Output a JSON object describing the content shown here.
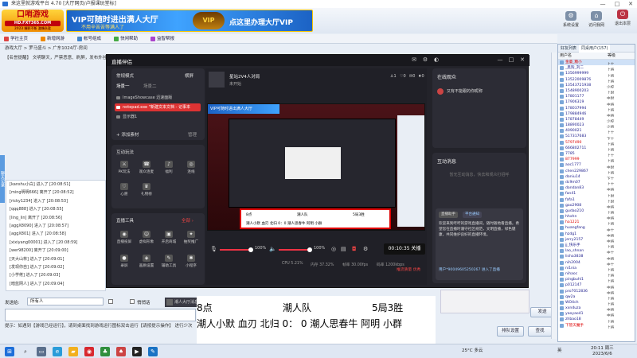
{
  "lobby": {
    "title": "来这里就游戏平台 4.70 [大厅网页/卢报课玩堂标]",
    "logo": {
      "line1": "口哨游戏",
      "line2": "HD.FXT365.COM",
      "line3": "2023 精彩不断 激情永驻"
    },
    "ad": {
      "main": "VIP可随时进出满人大厅",
      "sub": "不用辛苦苦等满人了",
      "badge": "VIP",
      "right": "点这里办理大厅VIP"
    },
    "tools": [
      {
        "label": "系统设置",
        "icon": "⚙"
      },
      {
        "label": "访问我网",
        "icon": "⌂"
      },
      {
        "label": "",
        "icon": "☺"
      },
      {
        "label": "退出本层",
        "icon": "⏻"
      }
    ],
    "window_controls": [
      "—",
      "□",
      "✕"
    ],
    "menu": [
      "学社主页",
      "新增网游",
      "帐号组成",
      "快闲帮助",
      "益智帮报"
    ],
    "breadcrumb": "游戏大厅 > 罗马盛斗 > 广东1024厅-房间",
    "room_tip": "【名誉提醒】 文明聊天，严禁恶意、刷屏，发布外挂",
    "sidebar_tab": "聊天记录",
    "chat_log": [
      "[kanshu小白] 进入了 [20:08:51]",
      "[ming明明666] 离开了 [20:08:52]",
      "[ricky1234] 进入了 [20:08:53]",
      "[qqq888] 进入了 [20:08:55]",
      "[ling_lin] 离开了 [20:08:56]",
      "[aggX8090] 进入了 [20:08:57]",
      "[aggX801] 进入了 [20:08:58]",
      "[xixiyang00001] 进入了 [20:08:59]",
      "[wer98200] 离开了 [20:09:00]",
      "[天大山林] 进入了 [20:09:01]",
      "[发现你自] 进入了 [20:09:02]",
      "[小学佬] 进入了 [20:09:03]",
      "[暗蓝网人] 进入了 [20:09:04]"
    ],
    "chat_target_label": "发送给:",
    "chat_target": "所有人",
    "chat_option": "悄悄话",
    "tip_bar": "提示：如遇到【游戏已经运行】，请到桌面找到游戏运行图标双击运行【请按提示操作】 进行少次",
    "buttons": {
      "send": "发送",
      "queue": "排队设置",
      "search": "查找"
    },
    "user_tabs": [
      "好友列表",
      "同桌用户(157)"
    ],
    "user_header": [
      "用户名",
      "等级"
    ],
    "users": [
      {
        "name": "金童_糖小",
        "rank": "上士",
        "red": true
      },
      {
        "name": "_黑狗_刘二",
        "rank": "上将",
        "red": false
      },
      {
        "name": "1356999999",
        "rank": "上将",
        "red": false
      },
      {
        "name": "13522009876",
        "rank": "上将",
        "red": false
      },
      {
        "name": "13543721938",
        "rank": "少校",
        "red": false
      },
      {
        "name": "1548900203",
        "rank": "上尉",
        "red": false
      },
      {
        "name": "17801177",
        "rank": "中尉",
        "red": false
      },
      {
        "name": "17906319",
        "rank": "中将",
        "red": false
      },
      {
        "name": "178037994",
        "rank": "上将",
        "red": false
      },
      {
        "name": "179884946",
        "rank": "中将",
        "red": false
      },
      {
        "name": "17878449",
        "rank": "少校",
        "red": false
      },
      {
        "name": "18890023",
        "rank": "少将",
        "red": false
      },
      {
        "name": "4090021",
        "rank": "上士",
        "red": false
      },
      {
        "name": "517317683",
        "rank": "下士",
        "red": false
      },
      {
        "name": "5797490",
        "rank": "上将",
        "red": true
      },
      {
        "name": "666802711",
        "rank": "上将",
        "red": false
      },
      {
        "name": "7785",
        "rank": "上士",
        "red": false
      },
      {
        "name": "877999",
        "rank": "上将",
        "red": true
      },
      {
        "name": "aoc1777",
        "rank": "中尉",
        "red": false
      },
      {
        "name": "chen229867",
        "rank": "上将",
        "red": false
      },
      {
        "name": "daniu14",
        "rank": "下士",
        "red": false
      },
      {
        "name": "dc9m07",
        "rank": "上士",
        "red": false
      },
      {
        "name": "dandan83",
        "rank": "中将",
        "red": false
      },
      {
        "name": "fan41",
        "rank": "上尉",
        "red": false
      },
      {
        "name": "fafa1",
        "rank": "上尉",
        "red": false
      },
      {
        "name": "gao2908",
        "rank": "中将",
        "red": false
      },
      {
        "name": "gudao210",
        "rank": "上将",
        "red": false
      },
      {
        "name": "hhxhn",
        "rank": "中将",
        "red": false
      },
      {
        "name": "ha1221",
        "rank": "上将",
        "red": true
      },
      {
        "name": "huangfang",
        "rank": "中士",
        "red": false
      },
      {
        "name": "hzdg1",
        "rank": "中将",
        "red": false
      },
      {
        "name": "jerry2157",
        "rank": "中将",
        "red": false
      },
      {
        "name": "jj_快乐手",
        "rank": "上将",
        "red": false
      },
      {
        "name": "lao_shnan",
        "rank": "中士",
        "red": false
      },
      {
        "name": "lisha3838",
        "rank": "中将",
        "red": false
      },
      {
        "name": "nih2004",
        "rank": "中士",
        "red": false
      },
      {
        "name": "ni1nia",
        "rank": "上将",
        "red": false
      },
      {
        "name": "nihaoc",
        "rank": "上将",
        "red": false
      },
      {
        "name": "pingbuhl1",
        "rank": "上将",
        "red": false
      },
      {
        "name": "p012147",
        "rank": "中将",
        "red": false
      },
      {
        "name": "pro7012836",
        "rank": "中将",
        "red": false
      },
      {
        "name": "qw2a",
        "rank": "上将",
        "red": false
      },
      {
        "name": "WO4ch",
        "rank": "上将",
        "red": false
      },
      {
        "name": "xxnduza",
        "rank": "中将",
        "red": false
      },
      {
        "name": "yaoyao41",
        "rank": "中将",
        "red": false
      },
      {
        "name": "zhbao18",
        "rank": "上将",
        "red": false
      },
      {
        "name": "下管天魔手",
        "rank": "上将",
        "red": true
      }
    ]
  },
  "stream": {
    "title": "直播伴侣",
    "scene_mode": "常规模式",
    "landscape": "横屏",
    "scene_tab1": "场景一",
    "scene_tab2": "场景二",
    "sources": [
      "ImageShowcase 迅速面版",
      "notepad.exe \"新建文本文档 - 记事本",
      "显示器1"
    ],
    "add_source": "添加素材",
    "manage": "管理",
    "interact_title": "互动玩法",
    "interact_items": [
      "PK玩法",
      "观众连麦",
      "福利",
      "连线",
      "心愿",
      "礼物榜"
    ],
    "tools_title": "直播工具",
    "tools_all": "全部 ›",
    "tools_items": [
      "直播投屏",
      "虚拟形象",
      "开启商城",
      "抽奖推广",
      "录屏",
      "画质设置",
      "辅助工具",
      "小程序"
    ],
    "stream_name": "星站2V4人对局",
    "stream_sub": "未开始",
    "stats_items": [
      "1",
      "0",
      "0",
      "0"
    ],
    "score_preview": {
      "row1": [
        "8点",
        "潮人队",
        "5局3胜"
      ],
      "row2": "潮人小默 血刃 北归 0：0 潮人思春牛 阿明 小群"
    },
    "mic_pct": "100%",
    "speaker_pct": "100%",
    "timer": "00:10:35 关播",
    "stats_bar": [
      "CPU 5.21%",
      "内存 37.32%",
      "帧率 30.00fps",
      "码率 1200kbps"
    ],
    "stream_quality": "推流质量 优秀",
    "online_title": "在线观众",
    "viewer": "又有不能跟的你昵称",
    "msg_title": "互动消息",
    "msg_empty": "暂无互动消息，快去和观众打招呼",
    "sys_tag": "直播助手",
    "sys_tag2": "平台通知",
    "sys_body": "欢迎来到哔哔的游戏直播间，随时随地看直播。希望您在直播时遵守社区规范，文明直播，绿色健康，共同维护良好的直播环境。",
    "sys_user": "用户*90049605250267 进入了直播",
    "toast": "潮人大厅消息"
  },
  "overlay": {
    "time": "8点",
    "team": "潮人队",
    "format": "5局3胜",
    "players": "潮人小默  血刃  北归 0： 0 潮人思春牛 阿明  小群"
  },
  "taskbar": {
    "weather": "25°C 多云",
    "time": "20:11 周三",
    "date": "2023/6/6",
    "ime": "英"
  }
}
